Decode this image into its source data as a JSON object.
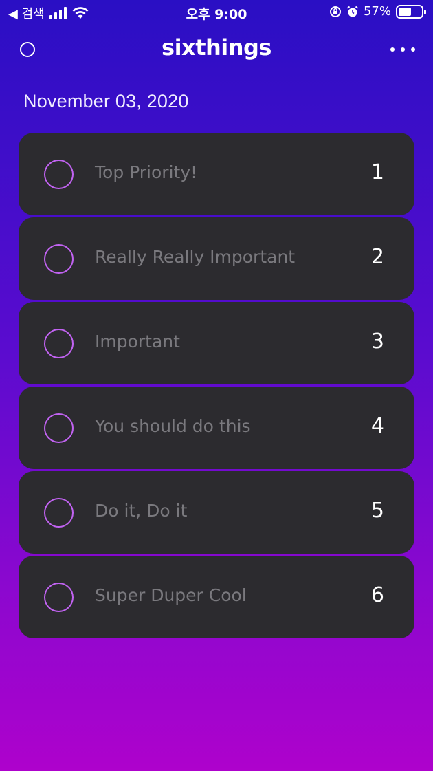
{
  "status_bar": {
    "back_label": "◀ 검색",
    "time": "오후 9:00",
    "battery": "57%",
    "battery_level": 0.57
  },
  "header": {
    "title": "sixthings"
  },
  "date": "November 03, 2020",
  "tasks": [
    {
      "label": "Top Priority!",
      "number": "1"
    },
    {
      "label": "Really Really Important",
      "number": "2"
    },
    {
      "label": "Important",
      "number": "3"
    },
    {
      "label": "You should do this",
      "number": "4"
    },
    {
      "label": "Do it, Do it",
      "number": "5"
    },
    {
      "label": "Super Duper Cool",
      "number": "6"
    }
  ],
  "colors": {
    "accent": "#c263f2",
    "card": "#2c2b2f",
    "gradient_top": "#2a0fc4",
    "gradient_bottom": "#ae02cc"
  }
}
